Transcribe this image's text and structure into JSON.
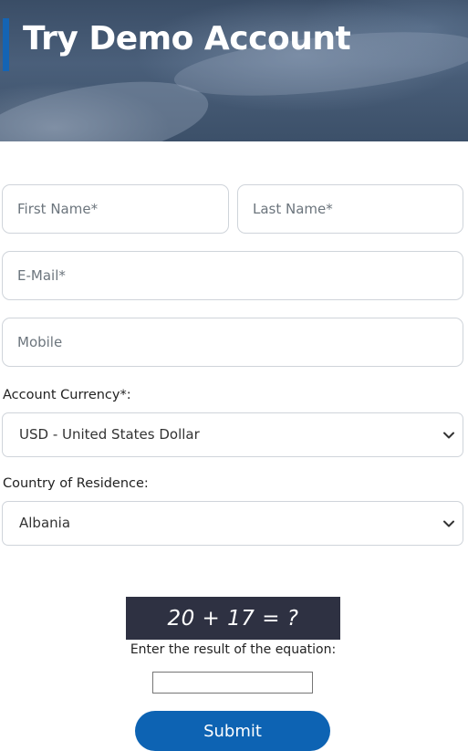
{
  "hero": {
    "title": "Try Demo Account"
  },
  "form": {
    "first_name": {
      "placeholder": "First Name*"
    },
    "last_name": {
      "placeholder": "Last Name*"
    },
    "email": {
      "placeholder": "E-Mail*"
    },
    "mobile": {
      "placeholder": "Mobile"
    },
    "currency": {
      "label": "Account Currency*:",
      "selected": "USD - United States Dollar"
    },
    "country": {
      "label": "Country of Residence:",
      "selected": "Albania"
    },
    "captcha": {
      "equation": "20 + 17 = ?",
      "hint": "Enter the result of the equation:",
      "answer": ""
    },
    "submit_label": "Submit"
  },
  "colors": {
    "accent": "#1464b4",
    "submit_bg": "#0d63b3",
    "captcha_bg": "#2e3142"
  },
  "icons": {
    "select_chevron": "chevron-down-icon"
  }
}
